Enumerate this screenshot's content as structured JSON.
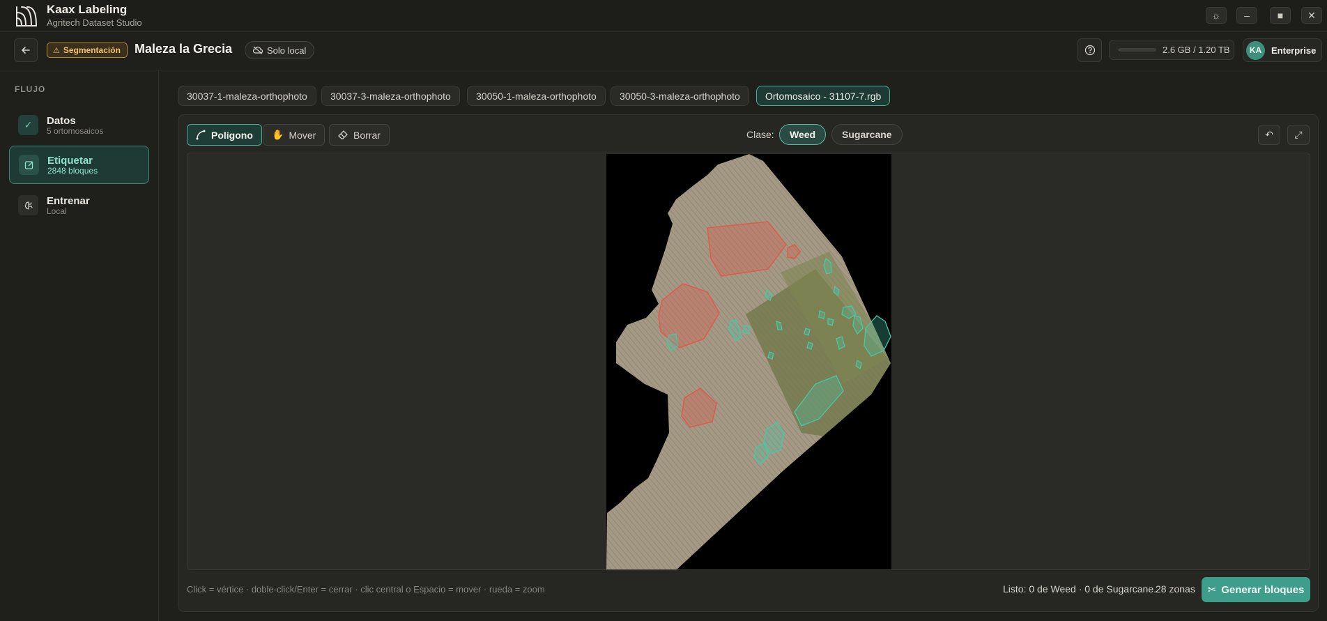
{
  "app": {
    "name": "Kaax Labeling",
    "subtitle": "Agritech Dataset Studio",
    "window_buttons": [
      "sun-icon",
      "minimize-icon",
      "maximize-icon",
      "close-icon"
    ]
  },
  "header": {
    "badge": "Segmentación",
    "project_title": "Maleza la Grecia",
    "mode_pill": "Solo local",
    "storage": {
      "text": "2.6 GB / 1.20 TB",
      "fraction": 0.002
    },
    "user": {
      "initials": "KA",
      "plan": "Enterprise"
    }
  },
  "sidebar": {
    "section_label": "FLUJO",
    "steps": [
      {
        "title": "Datos",
        "sub": "5 ortomosaicos",
        "icon": "check-icon"
      },
      {
        "title": "Etiquetar",
        "sub": "2848 bloques",
        "icon": "edit-icon"
      },
      {
        "title": "Entrenar",
        "sub": "Local",
        "icon": "brain-icon"
      }
    ]
  },
  "tabs": [
    "30037-1-maleza-orthophoto",
    "30037-3-maleza-orthophoto",
    "30050-1-maleza-orthophoto",
    "30050-3-maleza-orthophoto",
    "Ortomosaico - 31107-7.rgb"
  ],
  "toolbar": {
    "tools": [
      "Polígono",
      "Mover",
      "Borrar"
    ],
    "class_label": "Clase:",
    "classes": [
      "Weed",
      "Sugarcane"
    ],
    "selected_class": "Weed",
    "colors": {
      "weed": "#e05a4a",
      "sugarcane": "#48c8a8",
      "accent": "#3f9e8b"
    }
  },
  "footer": {
    "hint": "Click = vértice · doble-click/Enter = cerrar · clic central o Espacio = mover · rueda = zoom",
    "status": "Listo: 0 de Weed · 0 de Sugarcane.",
    "zones": "28 zonas",
    "generate_button": "Generar bloques"
  }
}
